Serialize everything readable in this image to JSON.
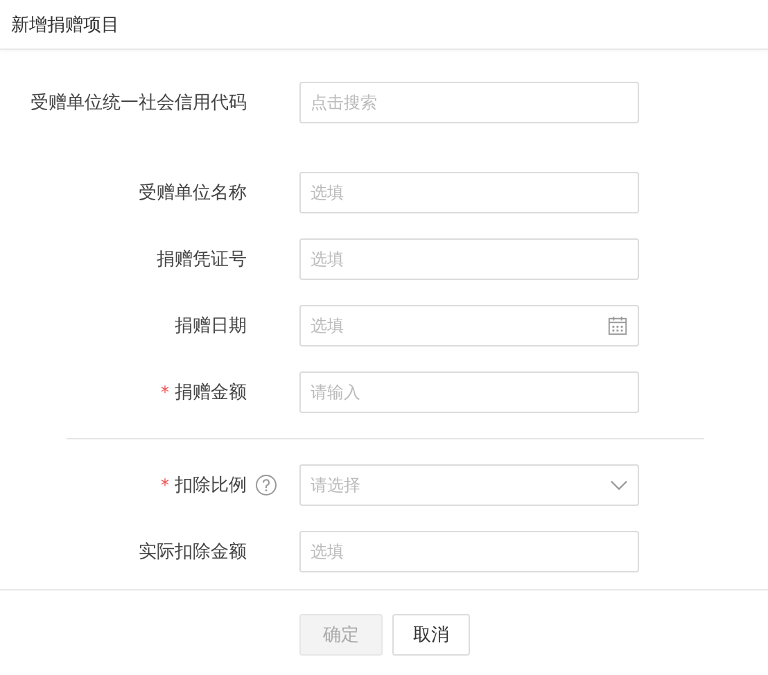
{
  "dialog": {
    "title": "新增捐赠项目"
  },
  "sections": [
    {
      "fields": [
        {
          "label": "受赠单位统一社会信用代码",
          "kind": "text",
          "placeholder": "点击搜索",
          "required": false,
          "help": false
        },
        {
          "label": "受赠单位名称",
          "kind": "text",
          "placeholder": "选填",
          "required": false,
          "help": false
        },
        {
          "label": "捐赠凭证号",
          "kind": "text",
          "placeholder": "选填",
          "required": false,
          "help": false
        },
        {
          "label": "捐赠日期",
          "kind": "date",
          "placeholder": "选填",
          "required": false,
          "help": false
        },
        {
          "label": "捐赠金额",
          "kind": "text",
          "placeholder": "请输入",
          "required": true,
          "required_mark": "*",
          "help": false
        }
      ]
    },
    {
      "fields": [
        {
          "label": "扣除比例",
          "kind": "select",
          "placeholder": "请选择",
          "required": true,
          "required_mark": "*",
          "help": true
        },
        {
          "label": "实际扣除金额",
          "kind": "text",
          "placeholder": "选填",
          "required": false,
          "help": false
        }
      ]
    }
  ],
  "buttons": [
    {
      "label": "确定",
      "disabled": true
    },
    {
      "label": "取消",
      "disabled": false
    }
  ]
}
